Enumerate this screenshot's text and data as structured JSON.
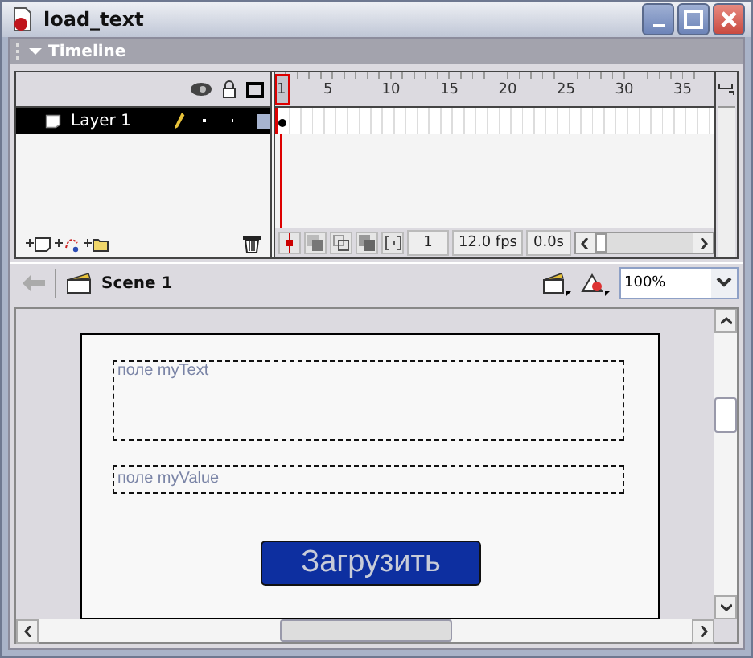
{
  "window": {
    "title": "load_text"
  },
  "timeline": {
    "title": "Timeline",
    "ruler": [
      "1",
      "5",
      "10",
      "15",
      "20",
      "25",
      "30",
      "35"
    ],
    "layers": [
      {
        "name": "Layer 1",
        "selected": true
      }
    ],
    "current_frame": "1",
    "frame_rate": "12.0 fps",
    "elapsed": "0.0s"
  },
  "scene_bar": {
    "scene": "Scene 1",
    "zoom": "100%"
  },
  "stage": {
    "fields": [
      {
        "text": "поле myText",
        "kind": "multiline"
      },
      {
        "text": "поле myValue",
        "kind": "single"
      }
    ],
    "button": "Загрузить"
  }
}
